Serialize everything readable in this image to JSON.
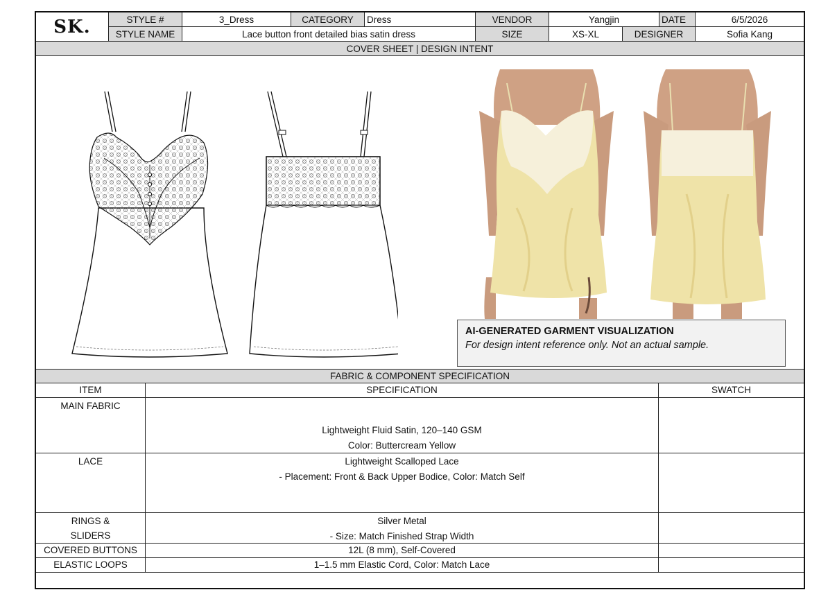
{
  "header": {
    "logo": "SK.",
    "style_no_label": "STYLE #",
    "style_no": "3_Dress",
    "category_label": "CATEGORY",
    "category": "Dress",
    "vendor_label": "VENDOR",
    "vendor": "Yangjin",
    "date_label": "DATE",
    "date": "6/5/2026",
    "style_name_label": "STYLE NAME",
    "style_name": "Lace button front detailed bias satin dress",
    "size_label": "SIZE",
    "size": "XS-XL",
    "designer_label": "DESIGNER",
    "designer": "Sofia Kang"
  },
  "cover": {
    "title": "COVER SHEET | DESIGN INTENT",
    "notice_title": "AI-GENERATED GARMENT VISUALIZATION",
    "notice_text": "For design intent reference only. Not an actual sample."
  },
  "spec": {
    "title": "FABRIC & COMPONENT SPECIFICATION",
    "col_item": "ITEM",
    "col_spec": "SPECIFICATION",
    "col_swatch": "SWATCH",
    "rows": [
      {
        "item": [
          "MAIN FABRIC"
        ],
        "spec": [
          "Lightweight Fluid Satin, 120–140 GSM",
          "Color: Buttercream Yellow"
        ]
      },
      {
        "item": [
          "LACE"
        ],
        "spec": [
          "Lightweight Scalloped Lace",
          "- Placement: Front & Back Upper Bodice, Color: Match Self"
        ]
      },
      {
        "item": [
          "RINGS &",
          "SLIDERS"
        ],
        "spec": [
          "Silver Metal",
          "- Size: Match Finished Strap Width"
        ]
      },
      {
        "item": [
          "COVERED BUTTONS"
        ],
        "spec": [
          "12L (8 mm), Self-Covered"
        ]
      },
      {
        "item": [
          "ELASTIC LOOPS"
        ],
        "spec": [
          "1–1.5 mm Elastic Cord, Color: Match Lace"
        ]
      }
    ]
  },
  "colors": {
    "header_gray": "#d9d9d9",
    "satin": "#efe3a8",
    "lace": "#f6f0dc"
  }
}
